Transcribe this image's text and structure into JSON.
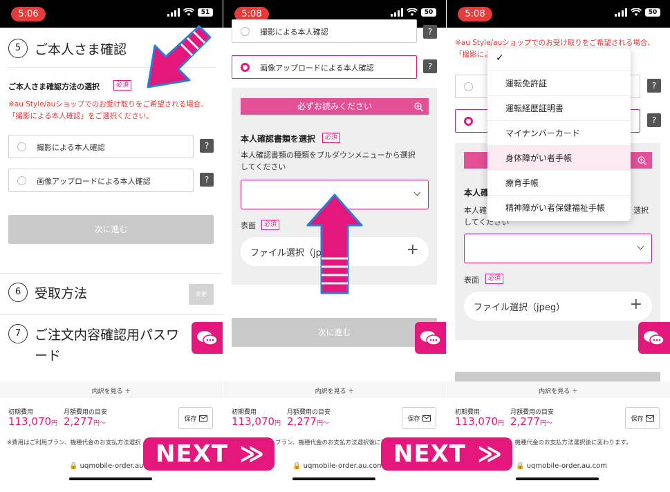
{
  "colors": {
    "accent": "#e4177c",
    "red_text": "#e33333",
    "status_pill": "#e53b3b",
    "disabled": "#c9c9c9"
  },
  "panel1": {
    "time": "5:06",
    "battery": "51",
    "section5_number": "5",
    "section5_title": "ご本人さま確認",
    "method_label": "ご本人さま確認方法の選択",
    "required": "必須",
    "note_line1": "※au Style/auショップでのお受け取りをご希望される場合、",
    "note_line2": "「撮影による本人確認」をご選択ください。",
    "option1": "撮影による本人確認",
    "option2": "画像アップロードによる本人確認",
    "help": "?",
    "next_button": "次に進む",
    "section6_number": "6",
    "section6_title": "受取方法",
    "change_button": "変更",
    "section7_number": "7",
    "section7_title_line1": "ご注文内容確認用パスワ",
    "section7_title_line2": "ード",
    "breakdown": "内訳を見る ＋",
    "initial_fee_label": "初期費用",
    "initial_fee_value": "113,070",
    "initial_fee_unit": "円",
    "monthly_label": "月額費用の目安",
    "monthly_value": "2,277",
    "monthly_unit": "円〜",
    "save": "保存",
    "footnote": "※費用はご利用プラン、機種代金のお支払方法選択",
    "url": "uqmobile-order.au.com"
  },
  "panel2": {
    "time": "5:08",
    "battery": "50",
    "option1": "撮影による本人確認",
    "option2": "画像アップロードによる本人確認",
    "help": "?",
    "must_read": "必ずお読みください",
    "doc_type_label": "本人確認書類を選択",
    "required": "必須",
    "doc_type_desc_line1": "本人確認書類の種類をプルダウンメニューから選択",
    "doc_type_desc_line2": "してください",
    "front_label": "表面",
    "file_select": "ファイル選択（jpeg）",
    "next_button": "次に進む",
    "breakdown": "内訳を見る ＋",
    "initial_fee_label": "初期費用",
    "initial_fee_value": "113,070",
    "initial_fee_unit": "円",
    "monthly_label": "月額費用の目安",
    "monthly_value": "2,277",
    "monthly_unit": "円〜",
    "save": "保存",
    "footnote": "プラン、機種代金のお支払方法選択後に変",
    "url": "uqmobile-order.au.com"
  },
  "panel3": {
    "time": "5:08",
    "battery": "50",
    "note_line1": "※au Style/auショップでのお受け取りをご希望される場合、",
    "note_line2": "「撮影による",
    "help": "?",
    "doc_type_label_partial": "本人確",
    "doc_desc_partial1": "本人確",
    "doc_desc_partial2": "してください",
    "doc_desc_partial3": "選択",
    "front_label": "表面",
    "required": "必須",
    "file_select": "ファイル選択（jpeg）",
    "dropdown_options": [
      "運転免許証",
      "運転経歴証明書",
      "マイナンバーカード",
      "身体障がい者手帳",
      "療育手帳",
      "精神障がい者保健福祉手帳"
    ],
    "breakdown": "内訳を見る ＋",
    "initial_fee_label": "初期費用",
    "initial_fee_value": "113,070",
    "initial_fee_unit": "円",
    "monthly_label": "月額費用の目安",
    "monthly_value": "2,277",
    "monthly_unit": "円〜",
    "save": "保存",
    "footnote": "、機種代金のお支払方法選択後に変わります。",
    "url": "uqmobile-order.au.com"
  },
  "banners": {
    "next1": "NEXT",
    "next2": "NEXT"
  }
}
